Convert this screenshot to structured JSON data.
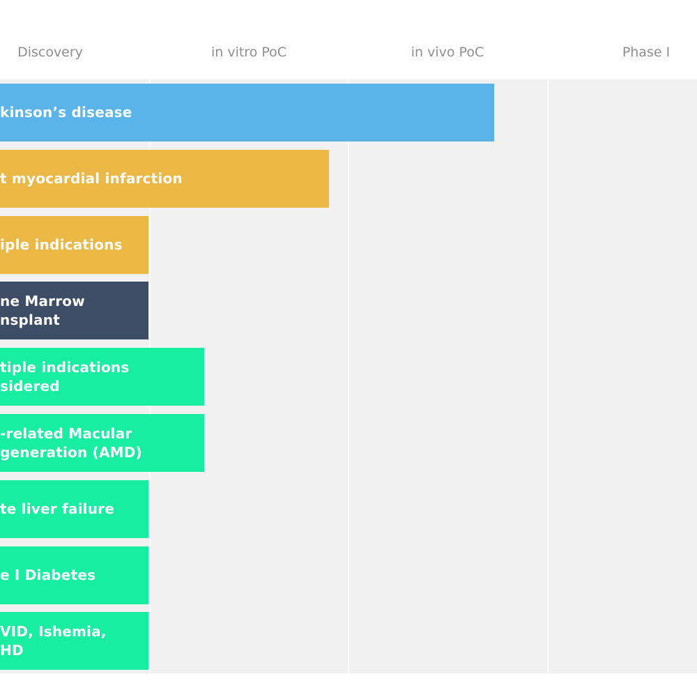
{
  "chart_data": {
    "type": "bar",
    "orientation": "horizontal",
    "stages": [
      "Discovery",
      "in vitro PoC",
      "in vivo PoC",
      "Phase I"
    ],
    "colors": {
      "blue": "#5ab4ea",
      "amber": "#ecb845",
      "navy": "#3d4d66",
      "green": "#17eda3",
      "column_bg": "#f1f1f1"
    },
    "bars": [
      {
        "label": "kinson’s disease",
        "stage_progress": 2.73,
        "color": "blue"
      },
      {
        "label": "t myocardial infarction",
        "stage_progress": 1.9,
        "color": "amber"
      },
      {
        "label": "iple indications",
        "stage_progress": 0.99,
        "color": "amber"
      },
      {
        "label": "ne Marrow\nnsplant",
        "stage_progress": 0.99,
        "color": "navy"
      },
      {
        "label": "tiple indications\nsidered",
        "stage_progress": 1.27,
        "color": "green"
      },
      {
        "label": "-related Macular\ngeneration (AMD)",
        "stage_progress": 1.27,
        "color": "green"
      },
      {
        "label": "te liver failure",
        "stage_progress": 0.99,
        "color": "green"
      },
      {
        "label": "e I Diabetes",
        "stage_progress": 0.99,
        "color": "green"
      },
      {
        "label": "VID, Ishemia,\nHD",
        "stage_progress": 0.99,
        "color": "green"
      }
    ]
  }
}
